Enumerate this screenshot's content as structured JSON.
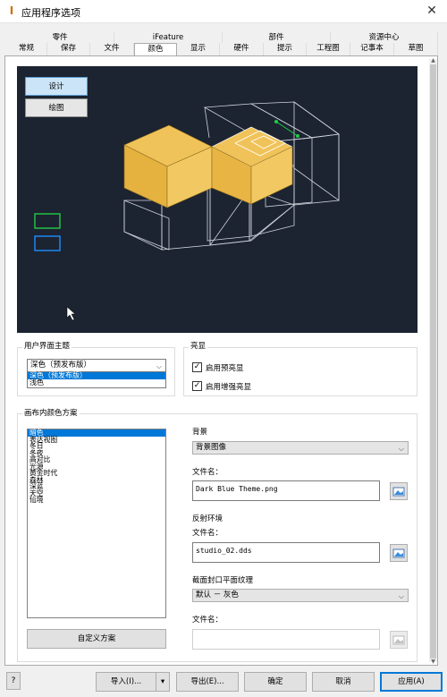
{
  "window": {
    "title": "应用程序选项",
    "close": "✕"
  },
  "tabs_top": [
    "零件",
    "iFeature",
    "部件",
    "资源中心"
  ],
  "tabs_bottom": [
    "常规",
    "保存",
    "文件",
    "颜色",
    "显示",
    "硬件",
    "提示",
    "工程图",
    "记事本",
    "草图"
  ],
  "preview": {
    "design_btn": "设计",
    "drawing_btn": "绘图"
  },
  "theme": {
    "group_label": "用户界面主题",
    "selected": "深色（预发布版）",
    "options": [
      "深色（预发布版）",
      "浅色"
    ]
  },
  "highlight": {
    "group_label": "亮显",
    "cb1_label": "启用预亮显",
    "cb2_label": "启用增强亮显",
    "check": "✓"
  },
  "scheme": {
    "group_label": "画布内颜色方案",
    "items": [
      "暗色",
      "表达视图",
      "冬日",
      "冬夜",
      "高对比",
      "光源",
      "黄金时代",
      "森林",
      "深蓝",
      "天空",
      "仙境"
    ],
    "custom_btn": "自定义方案"
  },
  "background": {
    "label": "背景",
    "value": "背景图像",
    "file_label": "文件名：",
    "file_value": "Dark Blue Theme.png"
  },
  "reflection": {
    "label": "反射环境",
    "file_label": "文件名：",
    "file_value": "studio_02.dds"
  },
  "section": {
    "label": "截面封口平面纹理",
    "value": "默认 － 灰色",
    "file_label": "文件名：",
    "file_value": ""
  },
  "footer": {
    "import": "导入(I)...",
    "export": "导出(E)...",
    "ok": "确定",
    "cancel": "取消",
    "apply": "应用(A)",
    "help": "?"
  }
}
